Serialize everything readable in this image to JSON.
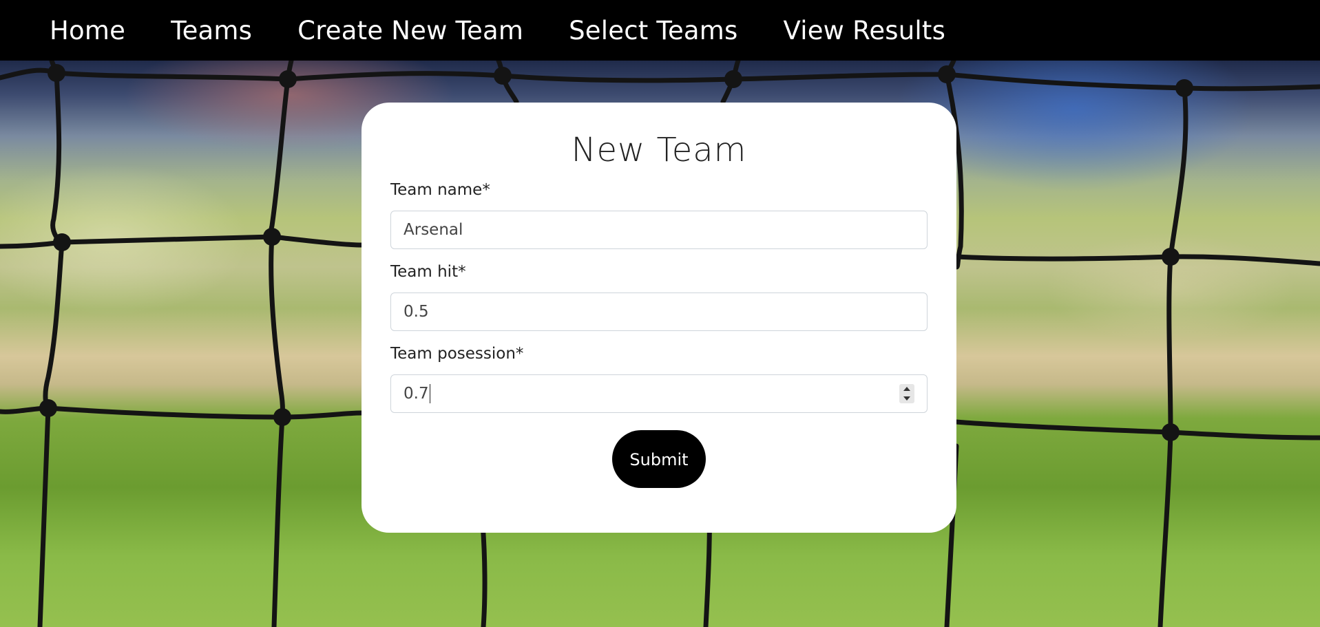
{
  "nav": {
    "items": [
      {
        "label": "Home"
      },
      {
        "label": "Teams"
      },
      {
        "label": "Create New Team"
      },
      {
        "label": "Select Teams"
      },
      {
        "label": "View Results"
      }
    ]
  },
  "form": {
    "title": "New Team",
    "fields": [
      {
        "label": "Team name*",
        "value": "Arsenal"
      },
      {
        "label": "Team hit*",
        "value": "0.5"
      },
      {
        "label": "Team posession*",
        "value": "0.7"
      }
    ],
    "submit_label": "Submit"
  },
  "background": {
    "description_icon": "soccer-goal-net-photo"
  },
  "colors": {
    "navbar": "#000000",
    "card": "#ffffff",
    "button": "#000000",
    "input_border": "#ced4da"
  }
}
